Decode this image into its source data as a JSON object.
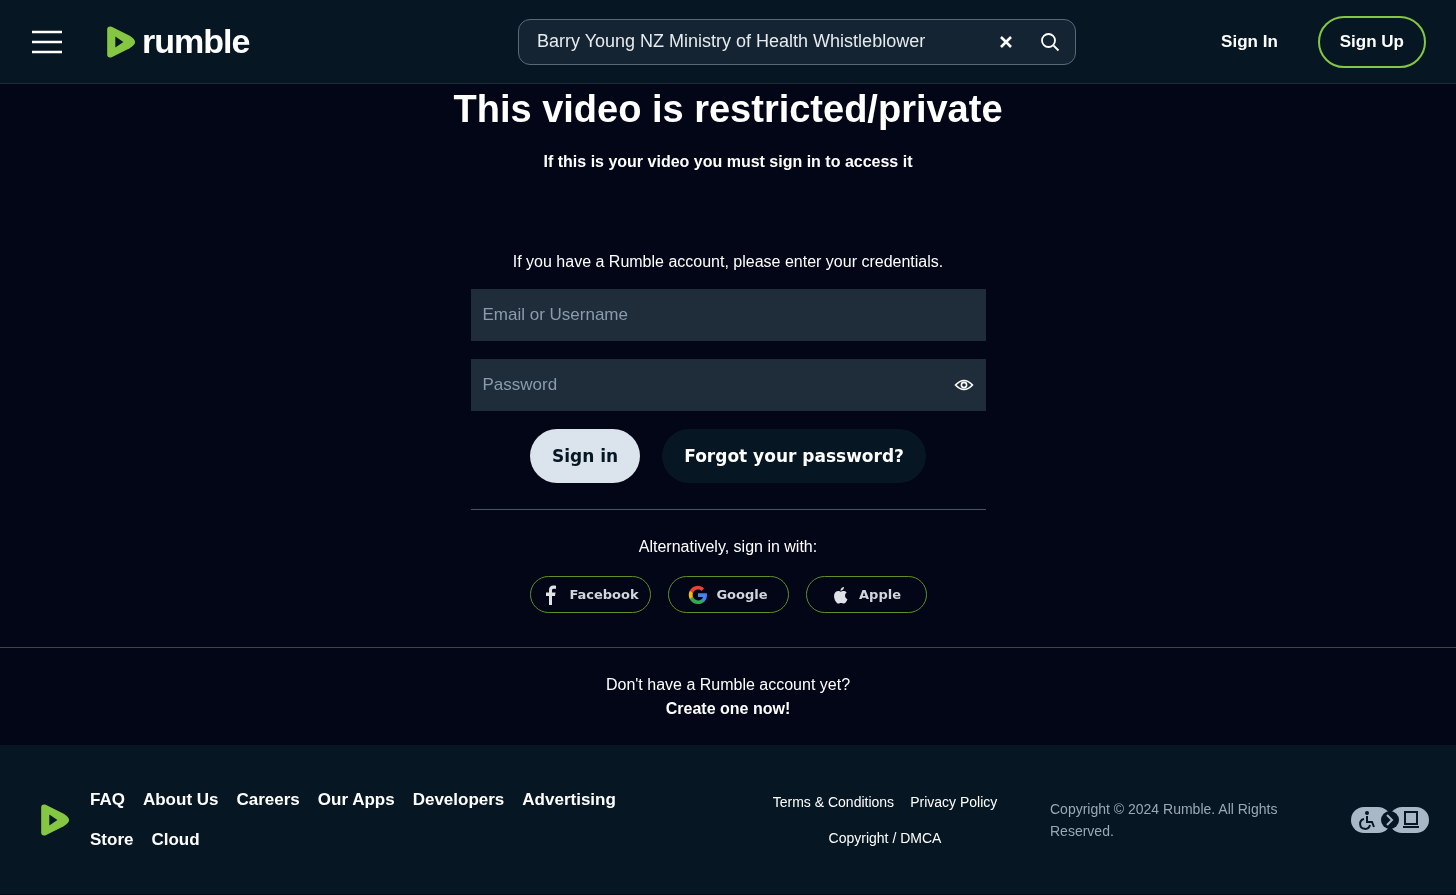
{
  "header": {
    "logo_text": "rumble",
    "search": {
      "value": "Barry Young NZ Ministry of Health Whistleblower"
    },
    "sign_in": "Sign In",
    "sign_up": "Sign Up"
  },
  "main": {
    "title": "This video is restricted/private",
    "subtitle": "If this is your video you must sign in to access it",
    "prompt": "If you have a Rumble account, please enter your credentials.",
    "fields": [
      {
        "kind": "text",
        "placeholder": "Email or Username"
      },
      {
        "kind": "password",
        "placeholder": "Password"
      }
    ],
    "sign_in_button": "Sign in",
    "forgot_button": "Forgot your password?",
    "alt_text": "Alternatively, sign in with:",
    "social": [
      {
        "kind": "facebook",
        "label": "Facebook"
      },
      {
        "kind": "google",
        "label": "Google"
      },
      {
        "kind": "apple",
        "label": "Apple"
      }
    ]
  },
  "signup_prompt": {
    "question": "Don't have a Rumble account yet?",
    "link": "Create one now!"
  },
  "footer": {
    "links": [
      "FAQ",
      "About Us",
      "Careers",
      "Our Apps",
      "Developers",
      "Advertising",
      "Store",
      "Cloud"
    ],
    "legal_links": [
      "Terms & Conditions",
      "Privacy Policy",
      "Copyright / DMCA"
    ],
    "copyright": "Copyright © 2024 Rumble. All Rights Reserved."
  }
}
